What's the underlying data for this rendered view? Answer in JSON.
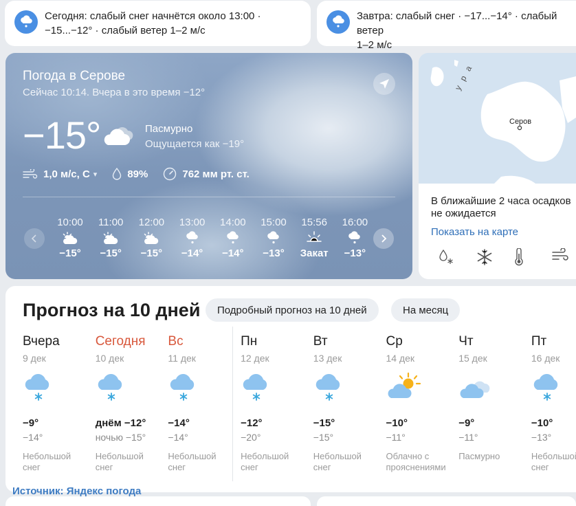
{
  "alerts": [
    {
      "text": "Сегодня: слабый снег начнётся около 13:00 ·\n−15...−12° · слабый ветер 1–2 м/с"
    },
    {
      "text": "Завтра: слабый снег · −17...−14° · слабый ветер\n1–2 м/с"
    }
  ],
  "current": {
    "city": "Погода в Серове",
    "now_line": "Сейчас 10:14. Вчера в это время −12°",
    "temperature": "−15°",
    "condition": "Пасмурно",
    "feels_like": "Ощущается как −19°",
    "wind": "1,0 м/с, С",
    "humidity": "89%",
    "pressure": "762 мм рт. ст."
  },
  "hourly": [
    {
      "time": "10:00",
      "icon": "cloud-sun-icon",
      "temp": "−15°"
    },
    {
      "time": "11:00",
      "icon": "cloud-sun-icon",
      "temp": "−15°"
    },
    {
      "time": "12:00",
      "icon": "cloud-sun-icon",
      "temp": "−15°"
    },
    {
      "time": "13:00",
      "icon": "cloud-snow-icon",
      "temp": "−14°"
    },
    {
      "time": "14:00",
      "icon": "cloud-snow-icon",
      "temp": "−14°"
    },
    {
      "time": "15:00",
      "icon": "cloud-snow-icon",
      "temp": "−13°"
    },
    {
      "time": "15:56",
      "icon": "sunset-icon",
      "temp": "Закат"
    },
    {
      "time": "16:00",
      "icon": "cloud-snow-icon",
      "temp": "−13°"
    }
  ],
  "map": {
    "city_label": "Серов",
    "region_label": "у р а",
    "nowcast": "В ближайшие 2 часа осадков не ожидается",
    "link": "Показать на карте",
    "layers": [
      "precipitation-icon",
      "snowflake-icon",
      "thermometer-icon",
      "wind-icon"
    ]
  },
  "forecast": {
    "title": "Прогноз на 10 дней",
    "btn_detailed": "Подробный прогноз на 10 дней",
    "btn_month": "На месяц",
    "days": [
      {
        "name": "Вчера",
        "date": "9 дек",
        "icon": "cloud-snow-icon",
        "hi": "−9°",
        "lo": "−14°",
        "desc": "Небольшой\nснег",
        "weekend": false
      },
      {
        "name": "Сегодня",
        "date": "10 дек",
        "icon": "cloud-snow-icon",
        "hi": "днём −12°",
        "lo": "ночью −15°",
        "desc": "Небольшой\nснег",
        "weekend": true
      },
      {
        "name": "Вс",
        "date": "11 дек",
        "icon": "cloud-snow-icon",
        "hi": "−14°",
        "lo": "−14°",
        "desc": "Небольшой\nснег",
        "weekend": true
      },
      {
        "name": "Пн",
        "date": "12 дек",
        "icon": "cloud-snow-icon",
        "hi": "−12°",
        "lo": "−20°",
        "desc": "Небольшой\nснег",
        "weekend": false
      },
      {
        "name": "Вт",
        "date": "13 дек",
        "icon": "cloud-snow-icon",
        "hi": "−15°",
        "lo": "−15°",
        "desc": "Небольшой\nснег",
        "weekend": false
      },
      {
        "name": "Ср",
        "date": "14 дек",
        "icon": "sun-cloud-icon",
        "hi": "−10°",
        "lo": "−11°",
        "desc": "Облачно с\nпрояснениями",
        "weekend": false
      },
      {
        "name": "Чт",
        "date": "15 дек",
        "icon": "overcast-icon",
        "hi": "−9°",
        "lo": "−11°",
        "desc": "Пасмурно",
        "weekend": false
      },
      {
        "name": "Пт",
        "date": "16 дек",
        "icon": "cloud-snow-icon",
        "hi": "−10°",
        "lo": "−13°",
        "desc": "Небольшой\nснег",
        "weekend": false
      }
    ]
  },
  "source": "Источник: Яндекс погода",
  "colors": {
    "accent": "#4a8fe3",
    "weekend": "#d8583c",
    "link": "#2f6fb8"
  }
}
